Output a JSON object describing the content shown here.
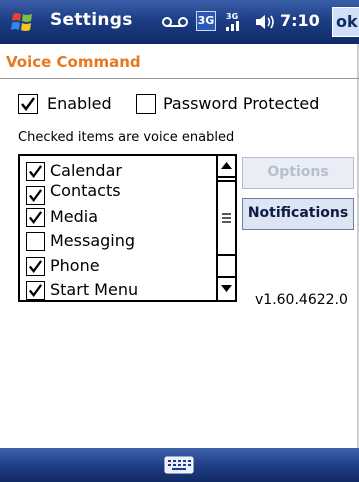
{
  "titlebar": {
    "app_title": "Settings",
    "clock": "7:10",
    "ok_label": "ok",
    "network_badge": "3G",
    "icons": [
      "windows-start-icon",
      "voicemail-icon",
      "3g-network-icon",
      "signal-strength-icon",
      "volume-icon"
    ]
  },
  "page": {
    "title": "Voice Command"
  },
  "options": {
    "enabled_label": "Enabled",
    "enabled_checked": true,
    "password_label": "Password Protected",
    "password_checked": false
  },
  "hint": "Checked items are voice enabled",
  "voice_items": [
    {
      "label": "Calendar",
      "checked": true
    },
    {
      "label": "Contacts",
      "checked": true
    },
    {
      "label": "Media",
      "checked": true
    },
    {
      "label": "Messaging",
      "checked": false
    },
    {
      "label": "Phone",
      "checked": true
    },
    {
      "label": "Start Menu",
      "checked": true
    }
  ],
  "buttons": {
    "options_label": "Options",
    "options_enabled": false,
    "notifications_label": "Notifications"
  },
  "version": "v1.60.4622.0",
  "bottombar": {
    "icons": [
      "keyboard-icon"
    ]
  },
  "colors": {
    "title_bar": "#1d3e86",
    "page_title": "#e8781e",
    "button_face": "#dde4f2",
    "disabled_text": "#b9bfcc"
  }
}
